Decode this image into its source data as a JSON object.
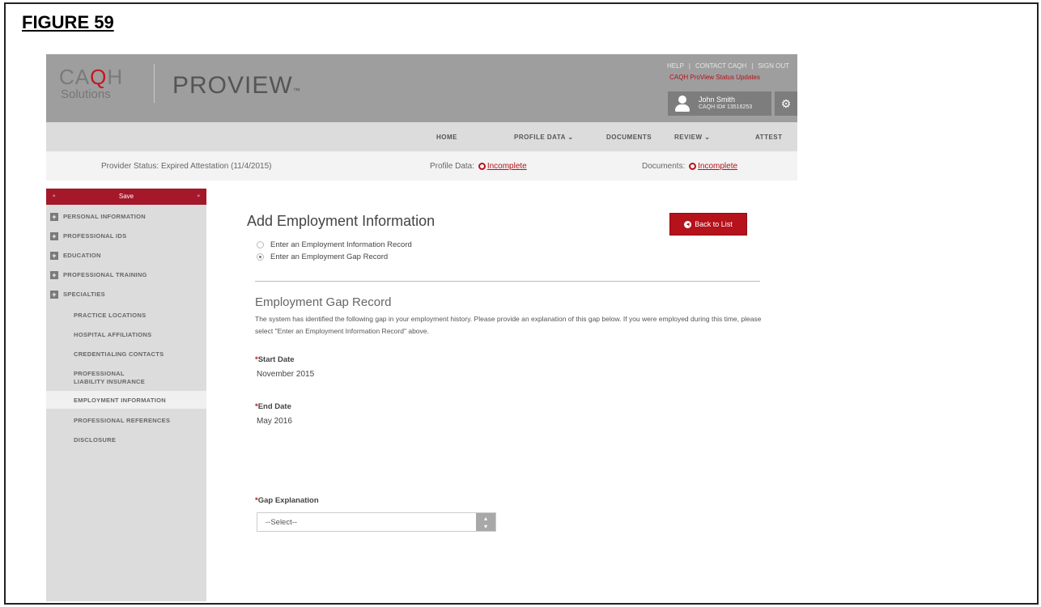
{
  "figure": {
    "label": "FIGURE 59"
  },
  "header": {
    "logo_top": "CAQH",
    "logo_bottom": "Solutions",
    "product": "PROVIEW",
    "toplinks": [
      "HELP",
      "CONTACT CAQH",
      "SIGN OUT"
    ],
    "status_link": "CAQH ProView Status Updates",
    "user_name": "John Smith",
    "user_id": "CAQH ID# 13516253"
  },
  "nav": {
    "items": [
      "HOME",
      "PROFILE DATA ⌄",
      "DOCUMENTS",
      "REVIEW ⌄",
      "ATTEST"
    ]
  },
  "statusbar": {
    "provider_label": "Provider Status:",
    "provider_value": "Expired Attestation (11/4/2015)",
    "profile_label": "Profile Data:",
    "profile_value": "Incomplete",
    "documents_label": "Documents:",
    "documents_value": "Incomplete"
  },
  "sidebar": {
    "save_label": "Save",
    "items": [
      "PERSONAL INFORMATION",
      "PROFESSIONAL IDS",
      "EDUCATION",
      "PROFESSIONAL TRAINING",
      "SPECIALTIES",
      "PRACTICE LOCATIONS",
      "HOSPITAL AFFILIATIONS",
      "CREDENTIALING CONTACTS",
      "PROFESSIONAL LIABILITY INSURANCE",
      "EMPLOYMENT INFORMATION",
      "PROFESSIONAL REFERENCES",
      "DISCLOSURE"
    ]
  },
  "main": {
    "title": "Add Employment Information",
    "back_label": "Back to List",
    "radio_1": "Enter an Employment Information Record",
    "radio_2": "Enter an Employment Gap Record",
    "section_title": "Employment Gap Record",
    "description": "The system has identified the following gap in your employment history. Please provide an explanation of this gap below. If you were employed during this time, please select \"Enter an Employment Information Record\" above.",
    "start_label": "Start Date",
    "start_value": "November 2015",
    "end_label": "End Date",
    "end_value": "May 2016",
    "gap_label": "Gap Explanation",
    "gap_select_value": "--Select--"
  },
  "colors": {
    "brand_red": "#b5121b",
    "header_gray": "#9e9e9e",
    "sidebar_gray": "#dcdcdc"
  }
}
